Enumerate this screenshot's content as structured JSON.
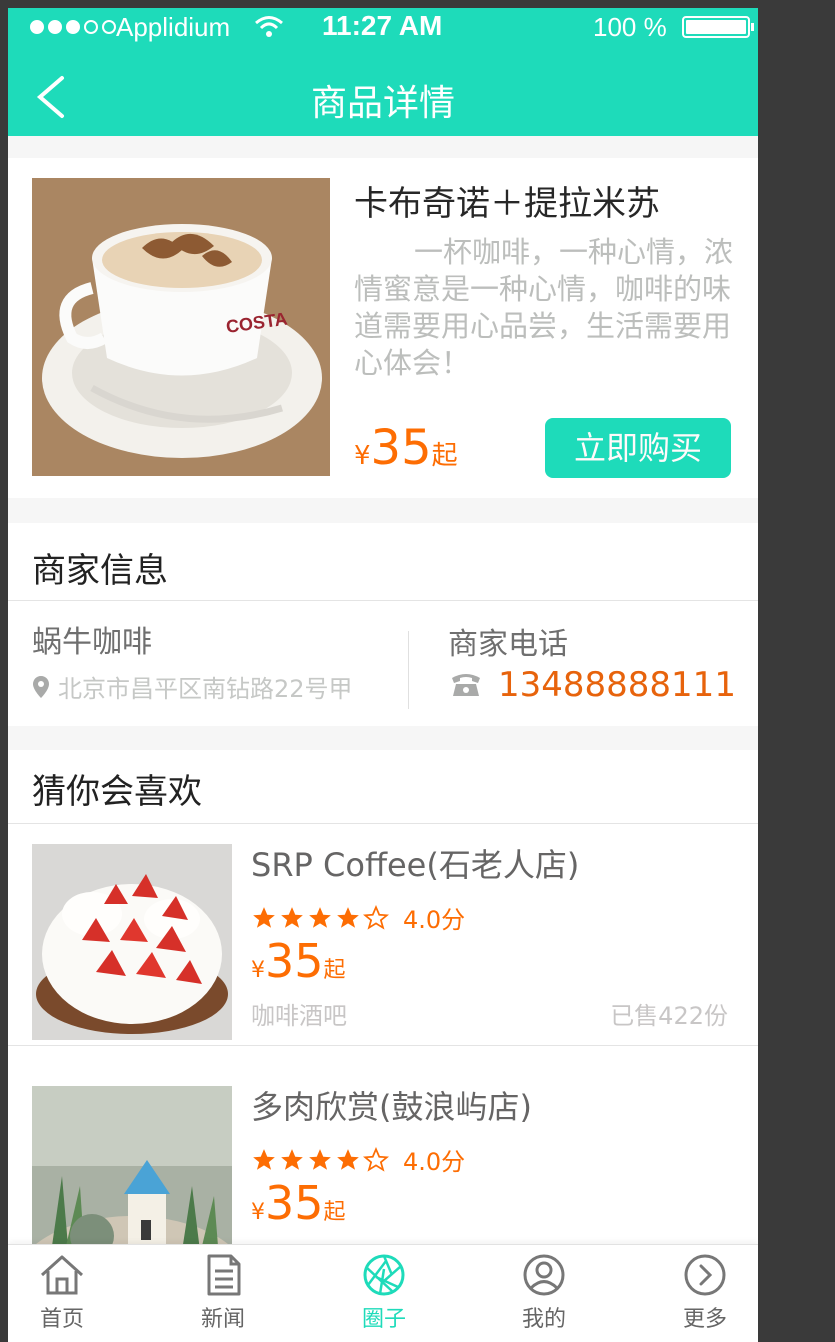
{
  "status": {
    "carrier": "Applidium",
    "time": "11:27 AM",
    "battery": "100 %"
  },
  "nav": {
    "title": "商品详情",
    "back_icon": "chevron-left-icon"
  },
  "product": {
    "name": "卡布奇诺＋提拉米苏",
    "description": "一杯咖啡，一种心情，浓情蜜意是一种心情，咖啡的味道需要用心品尝，生活需要用心体会！",
    "currency": "¥",
    "price": "35",
    "price_unit": "起",
    "buy_label": "立即购买"
  },
  "merchant": {
    "section_title": "商家信息",
    "name": "蜗牛咖啡",
    "address": "北京市昌平区南钻路22号甲",
    "phone_label": "商家电话",
    "phone": "13488888111"
  },
  "recommend": {
    "section_title": "猜你会喜欢",
    "items": [
      {
        "name": "SRP Coffee(石老人店)",
        "rating": 4,
        "score": "4.0分",
        "currency": "¥",
        "price": "35",
        "unit": "起",
        "category": "咖啡酒吧",
        "sold": "已售422份"
      },
      {
        "name": "多肉欣赏(鼓浪屿店)",
        "rating": 4,
        "score": "4.0分",
        "currency": "¥",
        "price": "35",
        "unit": "起",
        "category": "",
        "sold": ""
      }
    ]
  },
  "tabs": [
    {
      "label": "首页",
      "icon": "home-icon"
    },
    {
      "label": "新闻",
      "icon": "news-icon"
    },
    {
      "label": "圈子",
      "icon": "aperture-icon"
    },
    {
      "label": "我的",
      "icon": "user-icon"
    },
    {
      "label": "更多",
      "icon": "more-icon"
    }
  ],
  "colors": {
    "accent": "#1edbba",
    "price": "#fd6d03",
    "phone": "#e7630c",
    "muted": "#c6c8c6"
  }
}
